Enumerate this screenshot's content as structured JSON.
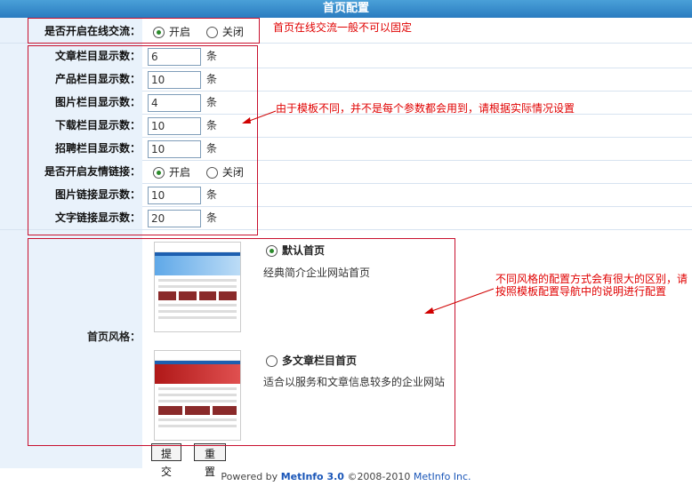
{
  "page": {
    "title": "首页配置"
  },
  "online_chat": {
    "label": "是否开启在线交流：",
    "options": [
      "开启",
      "关闭"
    ],
    "selected": "开启",
    "note": "首页在线交流一般不可以固定"
  },
  "fields": [
    {
      "label": "文章栏目显示数：",
      "value": "6",
      "unit": "条"
    },
    {
      "label": "产品栏目显示数：",
      "value": "10",
      "unit": "条"
    },
    {
      "label": "图片栏目显示数：",
      "value": "4",
      "unit": "条"
    },
    {
      "label": "下载栏目显示数：",
      "value": "10",
      "unit": "条"
    }
  ],
  "field5": {
    "label": "招聘栏目显示数：",
    "value": "10",
    "unit": "条"
  },
  "friendlink": {
    "label": "是否开启友情链接：",
    "options": [
      "开启",
      "关闭"
    ],
    "selected": "开启"
  },
  "link_fields": [
    {
      "label": "图片链接显示数：",
      "value": "10",
      "unit": "条"
    },
    {
      "label": "文字链接显示数：",
      "value": "20",
      "unit": "条"
    }
  ],
  "params_note": "由于模板不同，并不是每个参数都会用到，请根据实际情况设置",
  "home_style": {
    "label": "首页风格：",
    "styles": [
      {
        "name": "默认首页",
        "desc": "经典简介企业网站首页",
        "selected": true
      },
      {
        "name": "多文章栏目首页",
        "desc": "适合以服务和文章信息较多的企业网站",
        "selected": false
      }
    ],
    "note_line1": "不同风格的配置方式会有很大的区别，请",
    "note_line2": "按照模板配置导航中的说明进行配置"
  },
  "buttons": {
    "submit": "提交",
    "reset": "重置"
  },
  "footer": {
    "powered": "Powered by",
    "product": "MetInfo 3.0",
    "copyright": "©2008-2010",
    "company": "MetInfo Inc."
  },
  "colors": {
    "accent": "#2a7cc0",
    "note_red": "#e00000",
    "label_bg": "#e9f2fb"
  }
}
